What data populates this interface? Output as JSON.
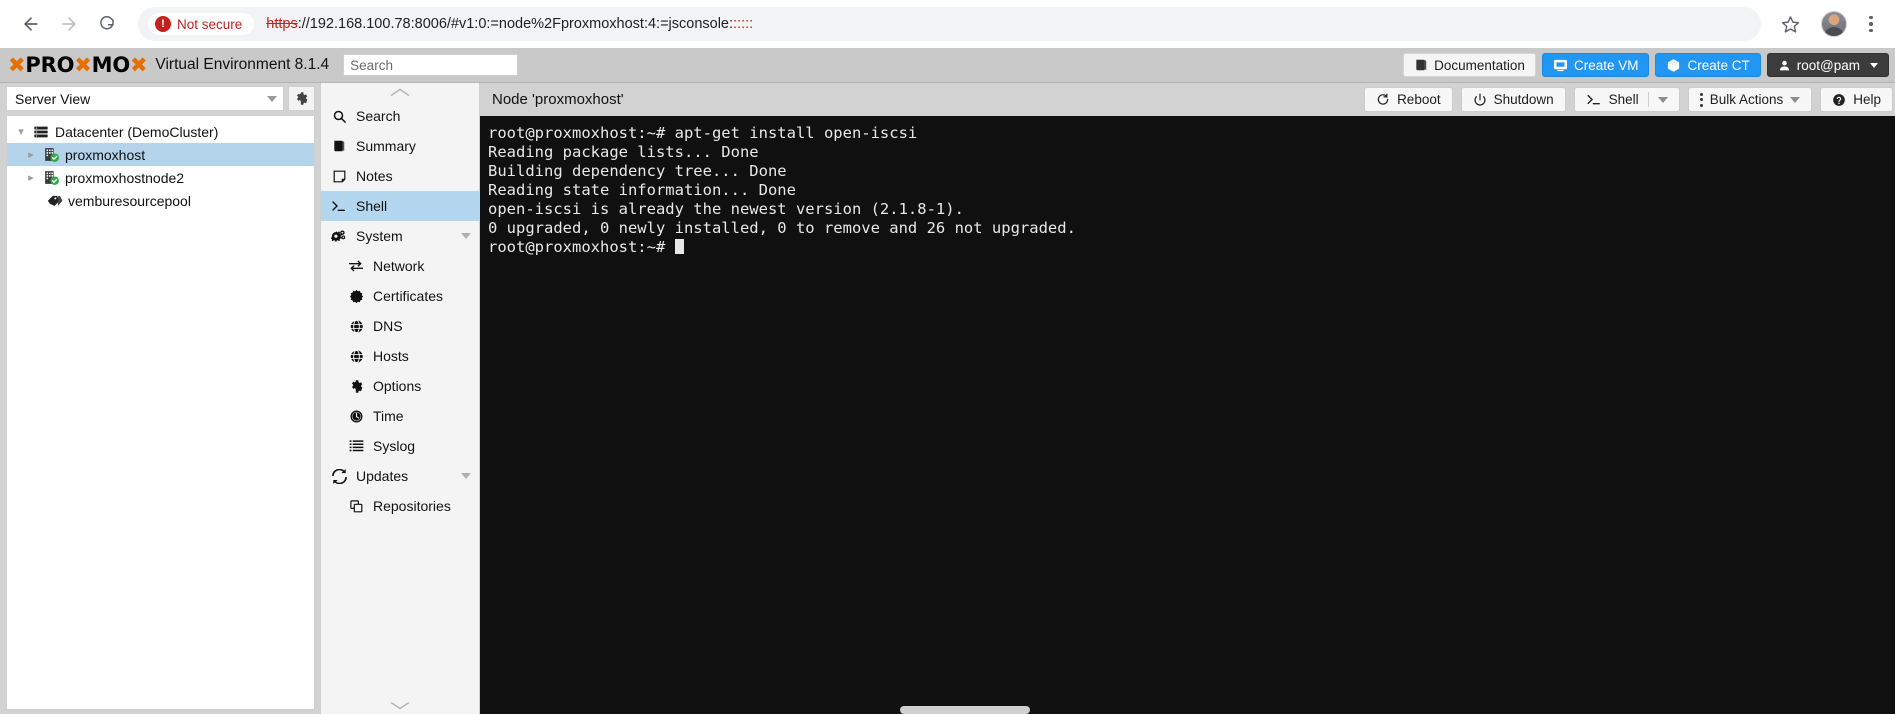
{
  "browser": {
    "back_icon": "back-arrow-icon",
    "forward_icon": "forward-arrow-icon",
    "reload_icon": "reload-icon",
    "security_badge": "Not secure",
    "url_scheme_struck": "https",
    "url_rest": "://192.168.100.78:8006/#v1:0:=node%2Fproxmoxhost:4:=jsconsole:",
    "url_trailing": ":::::",
    "star_icon": "bookmark-star-icon",
    "profile_icon": "profile-avatar-icon",
    "menu_icon": "kebab-menu-icon"
  },
  "pve_header": {
    "logo_text": "PROXMOX",
    "environment_title": "Virtual Environment 8.1.4",
    "search_placeholder": "Search",
    "buttons": [
      {
        "label": "Documentation",
        "icon": "book-icon",
        "style": "light"
      },
      {
        "label": "Create VM",
        "icon": "monitor-icon",
        "style": "blue"
      },
      {
        "label": "Create CT",
        "icon": "cube-icon",
        "style": "blue"
      },
      {
        "label": "root@pam",
        "icon": "user-icon",
        "style": "dark"
      }
    ]
  },
  "tree_panel": {
    "view_selector": "Server View",
    "view_caret_icon": "chevron-down-icon",
    "settings_icon": "gear-icon",
    "nodes": [
      {
        "label": "Datacenter (DemoCluster)",
        "icon": "datacenter-icon",
        "level": 1,
        "expanded": true,
        "selected": false
      },
      {
        "label": "proxmoxhost",
        "icon": "node-online-icon",
        "level": 2,
        "expanded": false,
        "selected": true
      },
      {
        "label": "proxmoxhostnode2",
        "icon": "node-online-icon",
        "level": 2,
        "expanded": false,
        "selected": false
      },
      {
        "label": "vemburesourcepool",
        "icon": "pool-tag-icon",
        "level": 3,
        "expanded": false,
        "selected": false
      }
    ]
  },
  "node_menu": {
    "scroll_up_icon": "chevron-up-icon",
    "scroll_down_icon": "chevron-down-icon",
    "items": [
      {
        "label": "Search",
        "icon": "search-icon",
        "sub": false,
        "selected": false,
        "caret": false
      },
      {
        "label": "Summary",
        "icon": "book-icon",
        "sub": false,
        "selected": false,
        "caret": false
      },
      {
        "label": "Notes",
        "icon": "note-icon",
        "sub": false,
        "selected": false,
        "caret": false
      },
      {
        "label": "Shell",
        "icon": "terminal-prompt-icon",
        "sub": false,
        "selected": true,
        "caret": false
      },
      {
        "label": "System",
        "icon": "gears-icon",
        "sub": false,
        "selected": false,
        "caret": true
      },
      {
        "label": "Network",
        "icon": "network-arrows-icon",
        "sub": true,
        "selected": false,
        "caret": false
      },
      {
        "label": "Certificates",
        "icon": "certificate-seal-icon",
        "sub": true,
        "selected": false,
        "caret": false
      },
      {
        "label": "DNS",
        "icon": "globe-icon",
        "sub": true,
        "selected": false,
        "caret": false
      },
      {
        "label": "Hosts",
        "icon": "globe-icon",
        "sub": true,
        "selected": false,
        "caret": false
      },
      {
        "label": "Options",
        "icon": "gear-icon",
        "sub": true,
        "selected": false,
        "caret": false
      },
      {
        "label": "Time",
        "icon": "clock-icon",
        "sub": true,
        "selected": false,
        "caret": false
      },
      {
        "label": "Syslog",
        "icon": "list-icon",
        "sub": true,
        "selected": false,
        "caret": false
      },
      {
        "label": "Updates",
        "icon": "refresh-icon",
        "sub": false,
        "selected": false,
        "caret": true
      },
      {
        "label": "Repositories",
        "icon": "copy-icon",
        "sub": true,
        "selected": false,
        "caret": false
      }
    ]
  },
  "content": {
    "title": "Node 'proxmoxhost'",
    "toolbar": [
      {
        "label": "Reboot",
        "icon": "reboot-icon",
        "split": false,
        "caret": false
      },
      {
        "label": "Shutdown",
        "icon": "power-icon",
        "split": false,
        "caret": false
      },
      {
        "label": "Shell",
        "icon": "terminal-prompt-icon",
        "split": true,
        "caret": true
      },
      {
        "label": "Bulk Actions",
        "icon": "vertical-dots-icon",
        "split": false,
        "caret": true
      },
      {
        "label": "Help",
        "icon": "question-circle-icon",
        "split": false,
        "caret": false
      }
    ]
  },
  "terminal": {
    "lines": [
      "root@proxmoxhost:~# apt-get install open-iscsi",
      "Reading package lists... Done",
      "Building dependency tree... Done",
      "Reading state information... Done",
      "open-iscsi is already the newest version (2.1.8-1).",
      "0 upgraded, 0 newly installed, 0 to remove and 26 not upgraded."
    ],
    "prompt": "root@proxmoxhost:~# ",
    "background": "#101010",
    "foreground": "#e8e8e8"
  },
  "colors": {
    "brand_orange": "#e57000",
    "accent_blue": "#2196f3",
    "selection_blue": "#b3d7ef",
    "chrome_gray": "#d2d2d2"
  }
}
